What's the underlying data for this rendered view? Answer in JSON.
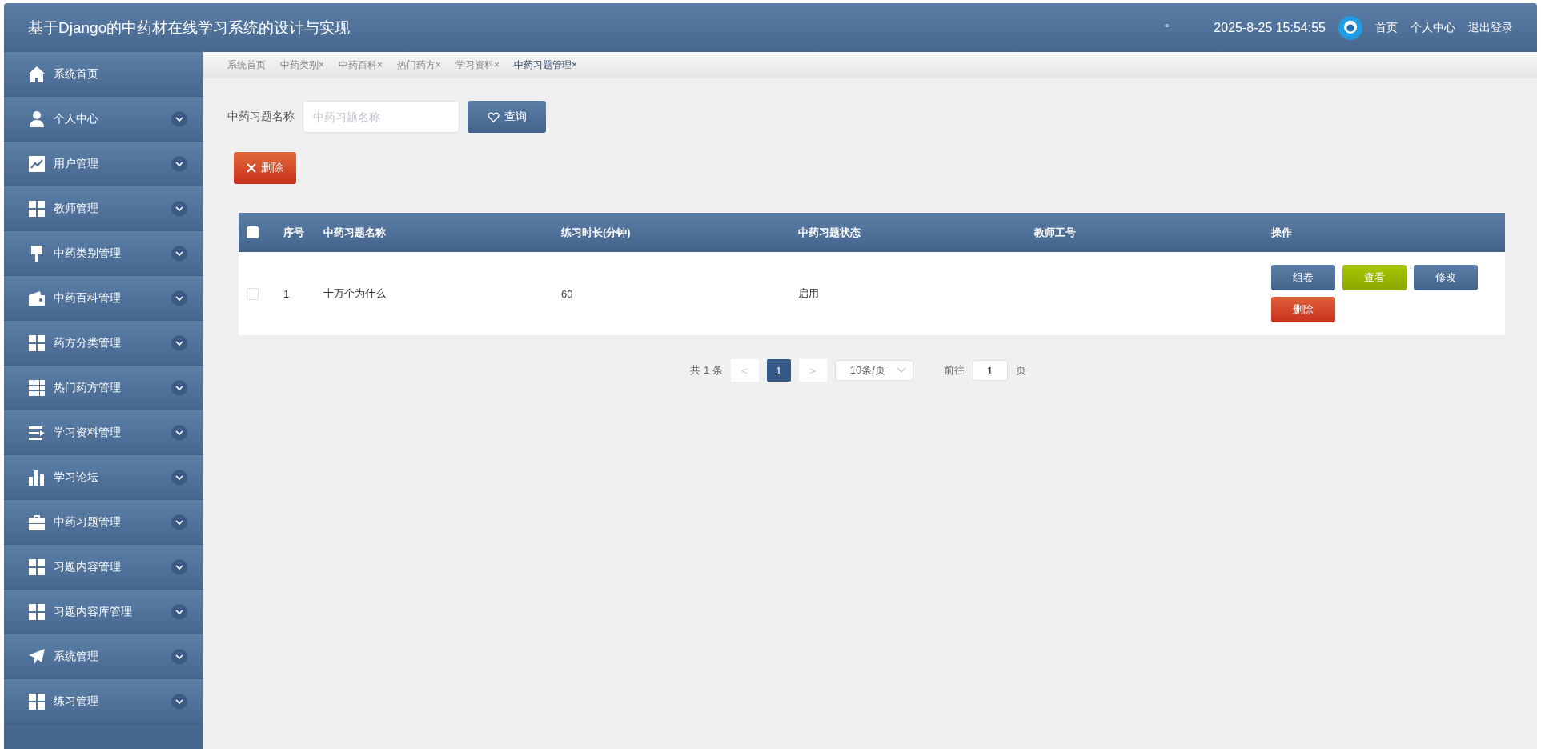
{
  "header": {
    "title": "基于Django的中药材在线学习系统的设计与实现",
    "mark": "°",
    "datetime": "2025-8-25 15:54:55",
    "links": [
      "首页",
      "个人中心",
      "退出登录"
    ]
  },
  "sidebar": {
    "items": [
      {
        "label": "系统首页",
        "expandable": false
      },
      {
        "label": "个人中心",
        "expandable": true
      },
      {
        "label": "用户管理",
        "expandable": true
      },
      {
        "label": "教师管理",
        "expandable": true
      },
      {
        "label": "中药类别管理",
        "expandable": true
      },
      {
        "label": "中药百科管理",
        "expandable": true
      },
      {
        "label": "药方分类管理",
        "expandable": true
      },
      {
        "label": "热门药方管理",
        "expandable": true
      },
      {
        "label": "学习资料管理",
        "expandable": true
      },
      {
        "label": "学习论坛",
        "expandable": true
      },
      {
        "label": "中药习题管理",
        "expandable": true
      },
      {
        "label": "习题内容管理",
        "expandable": true
      },
      {
        "label": "习题内容库管理",
        "expandable": true
      },
      {
        "label": "系统管理",
        "expandable": true
      },
      {
        "label": "练习管理",
        "expandable": true
      }
    ]
  },
  "tabs": [
    {
      "label": "系统首页",
      "selected": false
    },
    {
      "label": "中药类别",
      "close": "×",
      "selected": false
    },
    {
      "label": "中药百科",
      "close": "×",
      "selected": false
    },
    {
      "label": "热门药方",
      "close": "×",
      "selected": false
    },
    {
      "label": "学习资料",
      "close": "×",
      "selected": false
    },
    {
      "label": "中药习题管理",
      "close": "×",
      "selected": true
    }
  ],
  "search": {
    "label": "中药习题名称",
    "placeholder": "中药习题名称",
    "button": "查询"
  },
  "delete_button": "删除",
  "table": {
    "header_checked": false,
    "columns": [
      "序号",
      "中药习题名称",
      "练习时长(分钟)",
      "中药习题状态",
      "教师工号",
      "操作"
    ],
    "rows": [
      {
        "checked": false,
        "cells": [
          "1",
          "十万个为什么",
          "60",
          "启用",
          ""
        ],
        "actions": [
          {
            "label": "组卷",
            "kind": "primary"
          },
          {
            "label": "查看",
            "kind": "success"
          },
          {
            "label": "修改",
            "kind": "primary"
          },
          {
            "label": "删除",
            "kind": "danger"
          }
        ]
      }
    ]
  },
  "pagination": {
    "total": "共 1 条",
    "prev": "<",
    "pages": [
      {
        "label": "1",
        "selected": true
      }
    ],
    "next": ">",
    "page_size": "10条/页",
    "goto_label": "前往",
    "goto_value": "1",
    "goto_suffix": "页"
  }
}
